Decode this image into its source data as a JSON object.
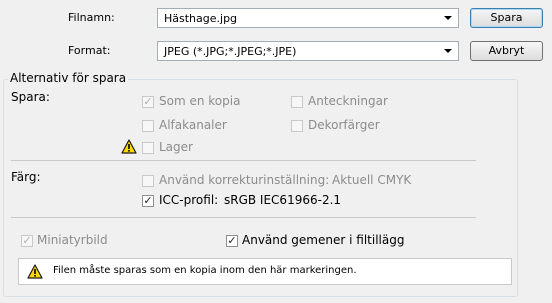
{
  "file": {
    "name_label": "Filnamn:",
    "name_value": "Hästhage.jpg",
    "format_label": "Format:",
    "format_value": "JPEG (*.JPG;*.JPEG;*.JPE)",
    "save_button": "Spara",
    "cancel_button": "Avbryt"
  },
  "options": {
    "legend": "Alternativ för spara",
    "save_heading": "Spara:",
    "as_copy": {
      "label": "Som en kopia",
      "checked": true,
      "enabled": false
    },
    "notes": {
      "label": "Anteckningar",
      "checked": false,
      "enabled": false
    },
    "alpha_channels": {
      "label": "Alfakanaler",
      "checked": false,
      "enabled": false
    },
    "spot_colors": {
      "label": "Dekorfärger",
      "checked": false,
      "enabled": false
    },
    "layers": {
      "label": "Lager",
      "checked": false,
      "enabled": false
    },
    "color_heading": "Färg:",
    "proof_setup": {
      "label": "Använd korrekturinställning:",
      "value": "Aktuell CMYK",
      "checked": false,
      "enabled": false
    },
    "icc_profile": {
      "label": "ICC-profil:",
      "value": "sRGB IEC61966-2.1",
      "checked": true,
      "enabled": true
    },
    "thumbnail": {
      "label": "Miniatyrbild",
      "checked": true,
      "enabled": false
    },
    "lowercase_ext": {
      "label": "Använd gemener i filtillägg",
      "checked": true,
      "enabled": true
    },
    "warning": "Filen måste sparas som en kopia inom den här markeringen."
  },
  "icons": {
    "warning": "warning-triangle-icon",
    "dropdown": "chevron-down-icon"
  }
}
